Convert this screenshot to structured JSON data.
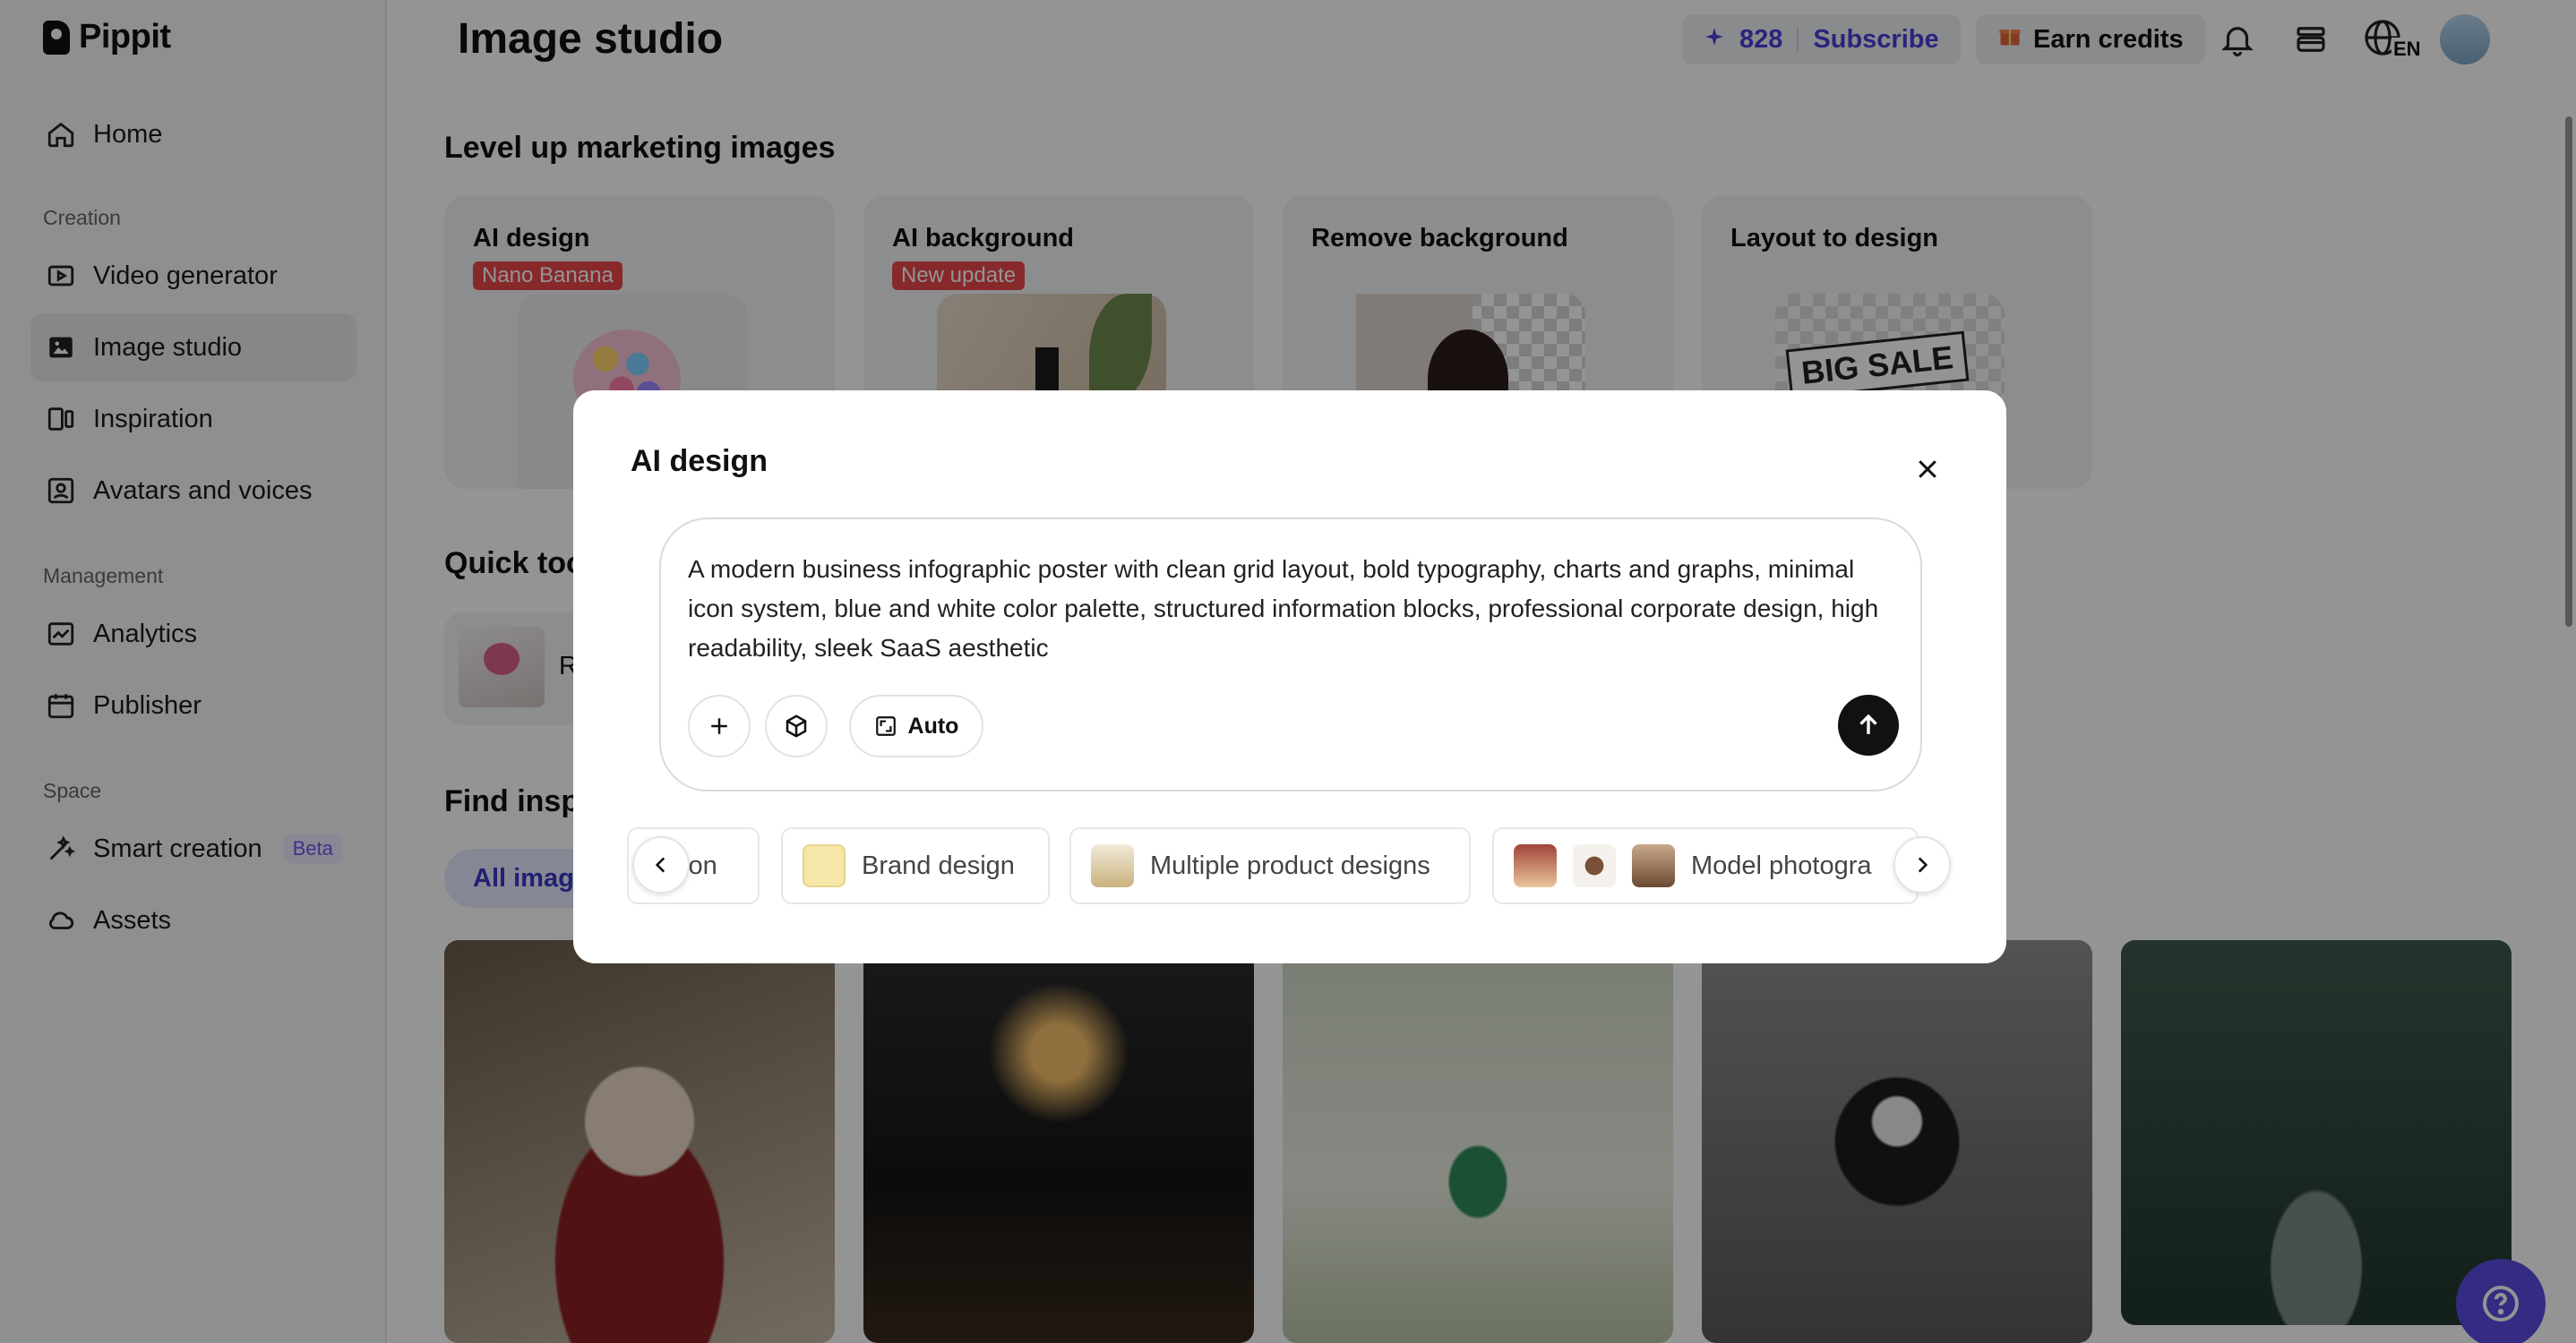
{
  "app": {
    "name": "Pippit"
  },
  "sidebar": {
    "items": [
      {
        "label": "Home"
      },
      {
        "label": "Video generator"
      },
      {
        "label": "Image studio"
      },
      {
        "label": "Inspiration"
      },
      {
        "label": "Avatars and voices"
      },
      {
        "label": "Analytics"
      },
      {
        "label": "Publisher"
      },
      {
        "label": "Smart creation",
        "badge": "Beta"
      },
      {
        "label": "Assets"
      }
    ],
    "sections": {
      "creation": "Creation",
      "management": "Management",
      "space": "Space"
    }
  },
  "header": {
    "title": "Image studio",
    "credits": "828",
    "subscribe_label": "Subscribe",
    "earn_label": "Earn credits",
    "language": "EN"
  },
  "main": {
    "section_marketing": "Level up marketing images",
    "feature_cards": [
      {
        "title": "AI design",
        "badge": "Nano Banana"
      },
      {
        "title": "AI background",
        "badge": "New update"
      },
      {
        "title": "Remove background"
      },
      {
        "title": "Layout to design",
        "art_text": "BIG SALE"
      }
    ],
    "section_quick": "Quick too",
    "quick_label": "R",
    "section_inspiration": "Find inspi",
    "tab_all": "All image"
  },
  "modal": {
    "title": "AI design",
    "prompt": "A modern business infographic poster with clean grid layout, bold typography, charts and graphs, minimal icon system, blue and white color palette, structured information blocks, professional corporate design, high readability, sleek SaaS aesthetic",
    "auto_label": "Auto",
    "chips": [
      {
        "label": "ion"
      },
      {
        "label": "Brand design"
      },
      {
        "label": "Multiple product designs"
      },
      {
        "label": "Model photogra"
      }
    ]
  },
  "colors": {
    "accent": "#5b4de0",
    "badge_red": "#e8474a",
    "link": "#4b3fd6"
  }
}
